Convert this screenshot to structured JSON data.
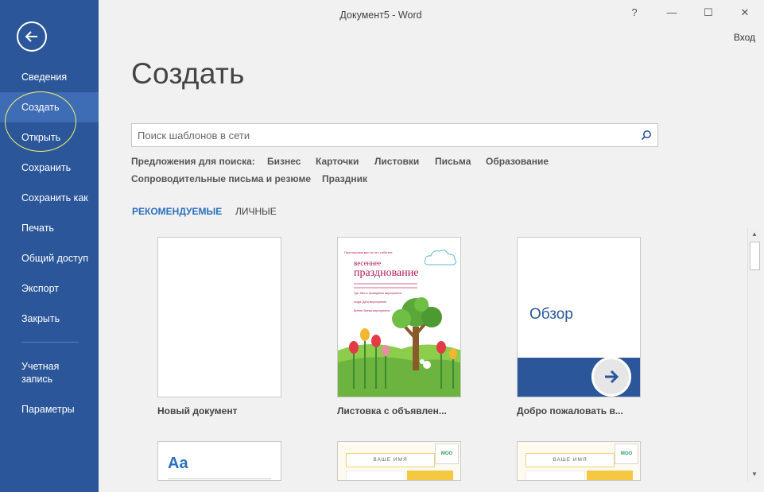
{
  "window": {
    "title": "Документ5 - Word",
    "help": "?",
    "minimize": "—",
    "maximize": "☐",
    "close": "✕",
    "signin": "Вход"
  },
  "sidebar": {
    "items": [
      {
        "label": "Сведения"
      },
      {
        "label": "Создать",
        "active": true
      },
      {
        "label": "Открыть"
      },
      {
        "label": "Сохранить"
      },
      {
        "label": "Сохранить как"
      },
      {
        "label": "Печать"
      },
      {
        "label": "Общий доступ"
      },
      {
        "label": "Экспорт"
      },
      {
        "label": "Закрыть"
      },
      {
        "label": "Учетная\nзапись"
      },
      {
        "label": "Параметры"
      }
    ]
  },
  "main": {
    "title": "Создать",
    "search": {
      "placeholder": "Поиск шаблонов в сети"
    },
    "suggestions": {
      "label": "Предложения для поиска:",
      "items": [
        "Бизнес",
        "Карточки",
        "Листовки",
        "Письма",
        "Образование",
        "Сопроводительные письма и резюме",
        "Праздник"
      ]
    },
    "tabs": [
      {
        "label": "РЕКОМЕНДУЕМЫЕ",
        "active": true
      },
      {
        "label": "ЛИЧНЫЕ"
      }
    ],
    "templates": [
      {
        "label": "Новый документ"
      },
      {
        "label": "Листовка с объявлен...",
        "preview": {
          "head": "Приглашаем вас на это событие",
          "title1": "весеннее",
          "title2": "празднование",
          "rows": [
            "Где:  Место проведения мероприятия",
            "Когда:  Дата мероприятия",
            "Время:  Время мероприятия"
          ]
        }
      },
      {
        "label": "Добро пожаловать в...",
        "preview": {
          "text": "Обзор"
        }
      },
      {
        "preview": {
          "text": "Aa"
        }
      },
      {
        "preview": {
          "band": "ВАШЕ ИМЯ",
          "badge": "MOO"
        }
      },
      {
        "preview": {
          "band": "ВАШЕ ИМЯ",
          "badge": "MOO"
        }
      }
    ]
  },
  "colors": {
    "sidebar": "#2b579a",
    "sidebar_active": "#3e6db5",
    "accent": "#2b6fbf",
    "background": "#f1f1f1"
  }
}
